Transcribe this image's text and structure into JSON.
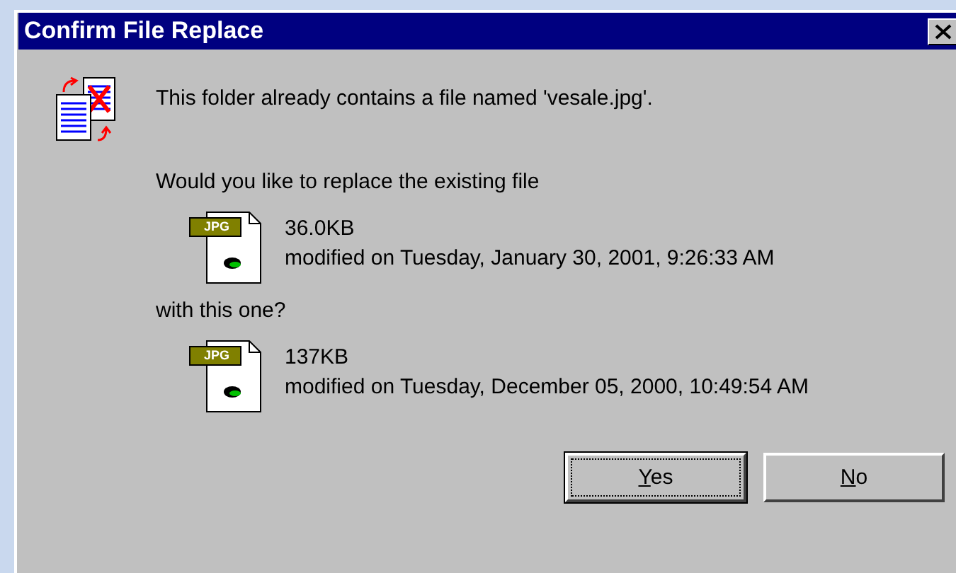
{
  "window": {
    "title": "Confirm File Replace"
  },
  "message": "This folder already contains a file named 'vesale.jpg'.",
  "question": "Would you like to replace the existing file",
  "existing_file": {
    "badge": "JPG",
    "size": "36.0KB",
    "modified": "modified on Tuesday, January 30, 2001, 9:26:33 AM"
  },
  "connector": "with this one?",
  "new_file": {
    "badge": "JPG",
    "size": "137KB",
    "modified": "modified on Tuesday, December 05, 2000, 10:49:54 AM"
  },
  "buttons": [
    {
      "label": "Yes",
      "default": true,
      "accelerator_first_letter": true
    },
    {
      "label": "No",
      "default": false,
      "accelerator_first_letter": true
    }
  ]
}
